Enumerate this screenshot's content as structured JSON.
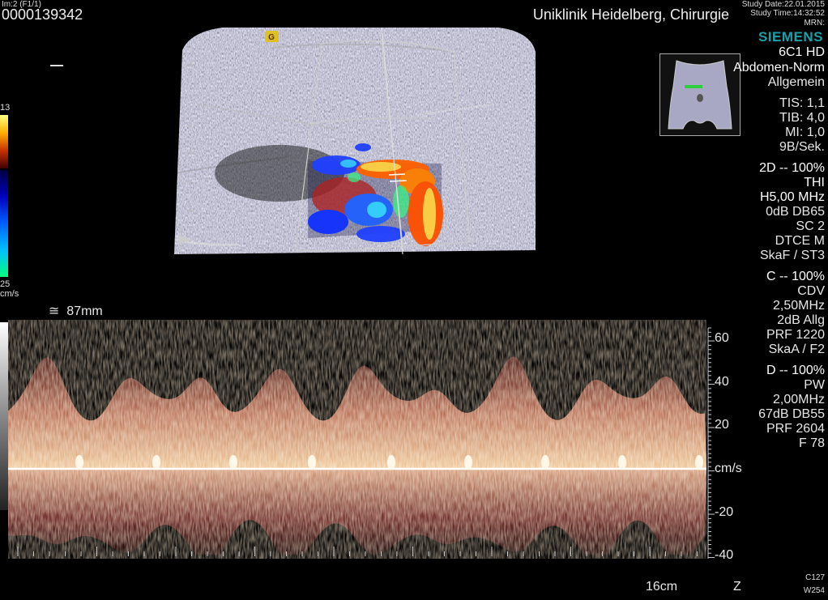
{
  "header": {
    "image_index": "Im:2 (F1/1)",
    "patient_id": "0000139342",
    "clinic": "Uniklinik Heidelberg, Chirurgie",
    "study_date": "Study Date:22.01.2015",
    "study_time": "Study Time:14:32:52",
    "mrn": "MRN:",
    "brand": "SIEMENS"
  },
  "probe": {
    "transducer": "6C1 HD",
    "preset": "Abdomen-Norm",
    "preset_sub": "Allgemein",
    "tis": "TIS: 1,1",
    "tib": "TIB: 4,0",
    "mi": "MI: 1,0",
    "frame_rate": "9B/Sek."
  },
  "mode_2d": {
    "title": "2D -- 100%",
    "thi": "THI",
    "freq": "H5,00 MHz",
    "gain": "0dB DB65",
    "sc": "SC 2",
    "dtce": "DTCE M",
    "map": "SkaF / ST3"
  },
  "mode_c": {
    "title": "C -- 100%",
    "cdv": "CDV",
    "freq": "2,50MHz",
    "gain": "2dB Allg",
    "prf": "PRF 1220",
    "map": "SkaA / F2"
  },
  "mode_d": {
    "title": "D -- 100%",
    "pw": "PW",
    "freq": "2,00MHz",
    "gain": "67dB DB55",
    "prf": "PRF 2604",
    "filter": "F 78"
  },
  "color_scale": {
    "top_value": "13",
    "bottom_value": "25",
    "unit": "cm/s"
  },
  "doppler": {
    "depth_symbol": "≅",
    "depth": "87mm",
    "ticks": [
      "60",
      "40",
      "20",
      "cm/s",
      "-20",
      "-40"
    ]
  },
  "footer": {
    "depth_cm": "16cm",
    "z_label": "Z",
    "c_value": "C127",
    "w_value": "W254"
  },
  "colors": {
    "brand": "#19a0a8",
    "baseline": "#ffffff",
    "marker": "#2fd040"
  },
  "icons": {
    "probe_orientation": "orientation-marker-icon",
    "focus": "focus-arrow-icon",
    "body_marker": "abdomen-body-marker-icon"
  }
}
